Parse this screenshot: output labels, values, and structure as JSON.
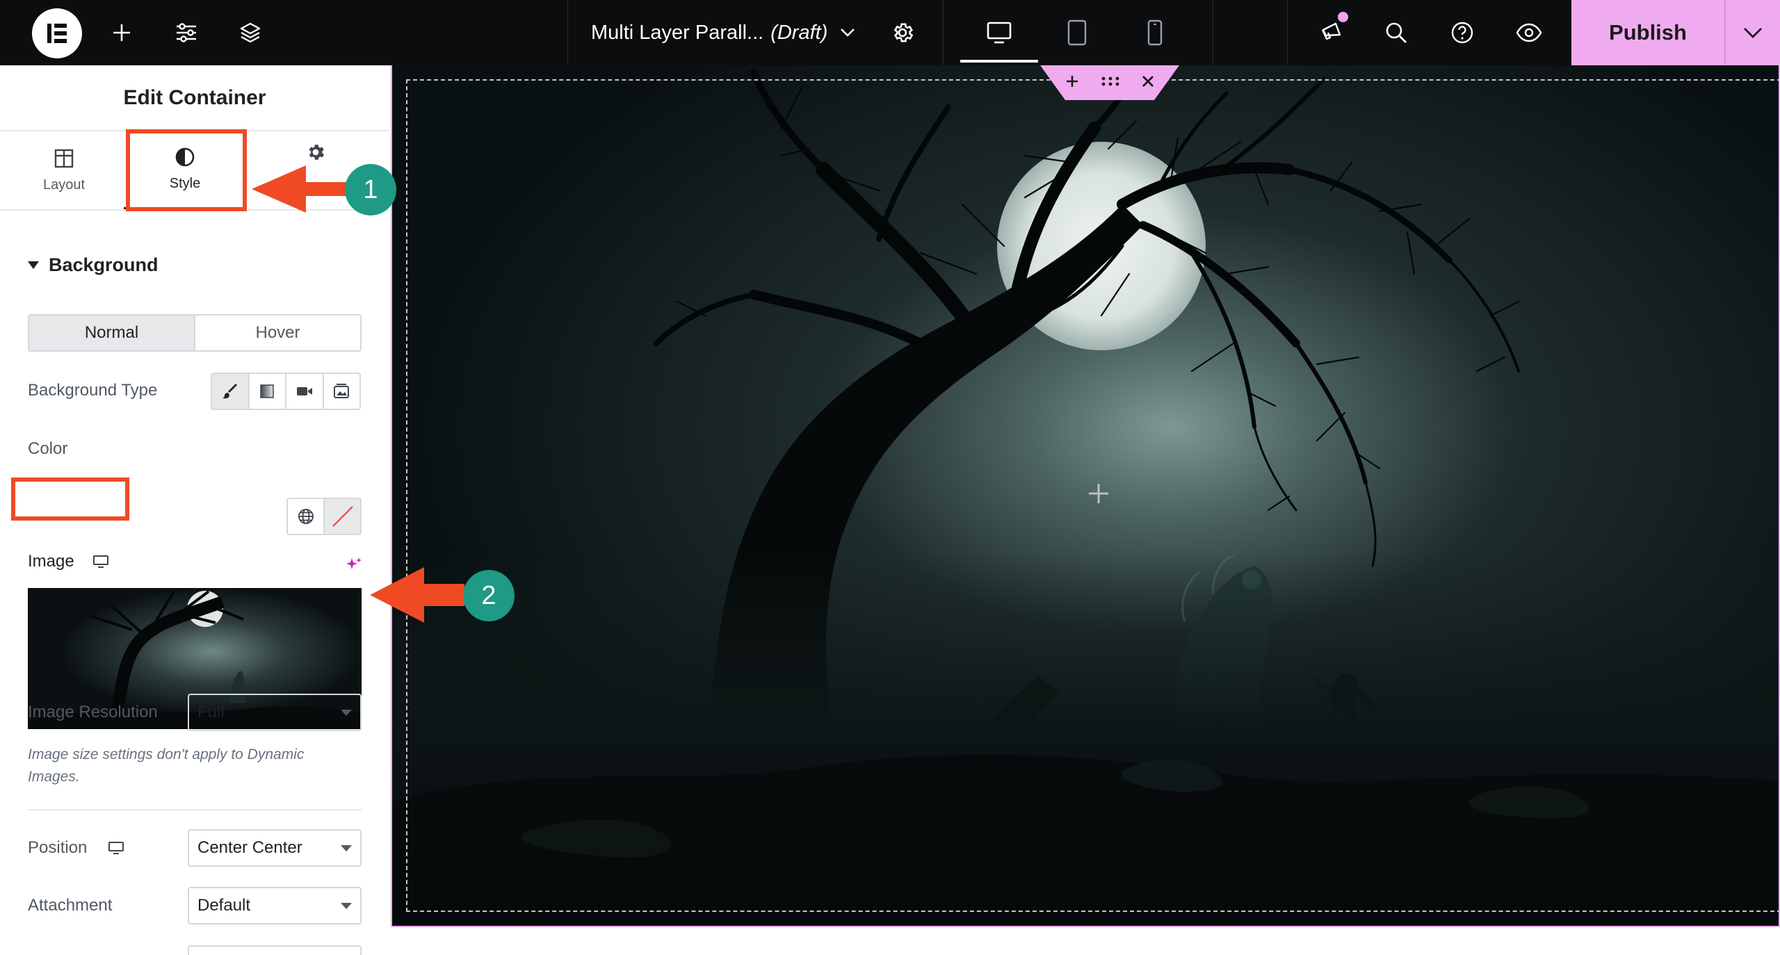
{
  "topbar": {
    "doc_title": "Multi Layer Parall...",
    "doc_status": "(Draft)",
    "publish_label": "Publish"
  },
  "panel": {
    "title": "Edit Container",
    "tabs": [
      {
        "label": "Layout"
      },
      {
        "label": "Style"
      },
      {
        "label": ""
      }
    ],
    "section_title": "Background",
    "state_tabs": [
      "Normal",
      "Hover"
    ],
    "background_type_label": "Background Type",
    "color_label": "Color",
    "image_label": "Image",
    "image_resolution_label": "Image Resolution",
    "image_resolution_value": "Full",
    "image_note": "Image size settings don't apply to Dynamic Images.",
    "position_label": "Position",
    "position_value": "Center Center",
    "attachment_label": "Attachment",
    "attachment_value": "Default"
  },
  "annotations": {
    "badge_1": "1",
    "badge_2": "2",
    "color": "#ef4a24",
    "badge_color": "#1e9a86"
  },
  "colors": {
    "accent": "#f0abf0",
    "topbar_bg": "#0c0d0e"
  }
}
